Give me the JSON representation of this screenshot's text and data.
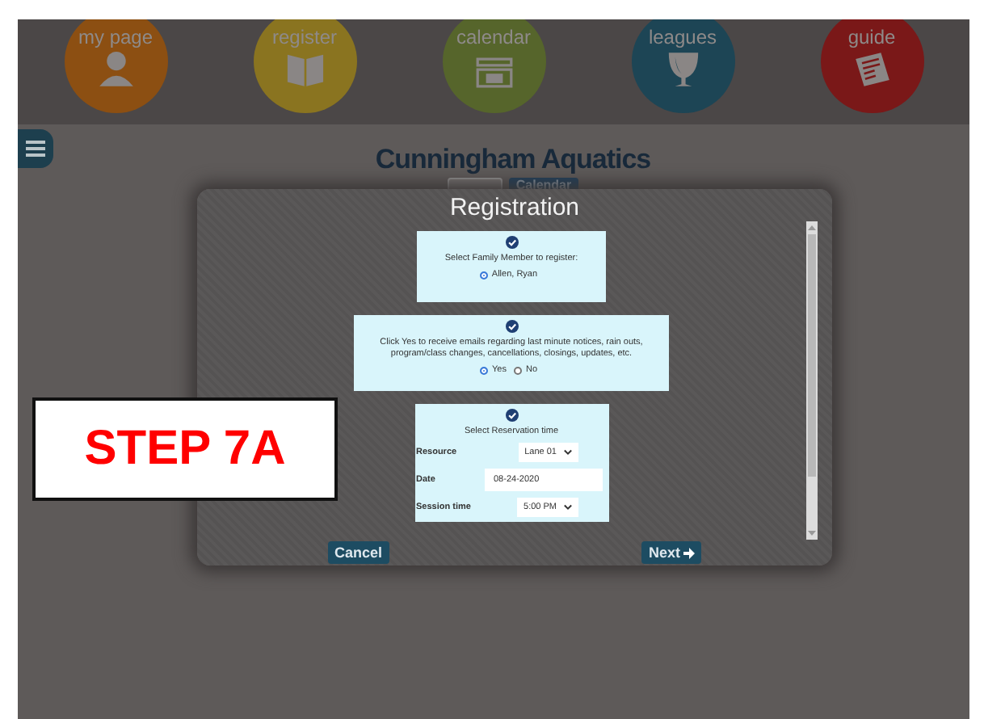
{
  "nav": [
    {
      "label": "my page",
      "color": "#8c4f12",
      "kind": "person"
    },
    {
      "label": "register",
      "color": "#8a7420",
      "kind": "book"
    },
    {
      "label": "calendar",
      "color": "#56652b",
      "kind": "calendar"
    },
    {
      "label": "leagues",
      "color": "#1d4555",
      "kind": "trophy"
    },
    {
      "label": "guide",
      "color": "#7a1818",
      "kind": "newspaper"
    }
  ],
  "site_title": "Cunningham Aquatics",
  "header_buttons": [
    {
      "kind": "plain"
    },
    {
      "kind": "calendar",
      "label": "Calendar"
    }
  ],
  "modal": {
    "title": "Registration",
    "sections": [
      {
        "kind": "choice",
        "prompt": "Select Family Member to register:",
        "options": [
          {
            "label": "Allen, Ryan",
            "selected": true
          }
        ]
      },
      {
        "kind": "choice",
        "prompt": "Click Yes to receive emails regarding last minute notices, rain outs, program/class changes, cancellations, closings, updates, etc.",
        "options": [
          {
            "label": "Yes",
            "selected": true
          },
          {
            "label": "No",
            "selected": false
          }
        ]
      },
      {
        "kind": "form",
        "prompt": "Select Reservation time",
        "fields": [
          {
            "label": "Resource",
            "kind": "select",
            "value": "Lane 01"
          },
          {
            "label": "Date",
            "kind": "input",
            "value": "08-24-2020"
          },
          {
            "label": "Session time",
            "kind": "select",
            "value": "5:00 PM"
          }
        ]
      }
    ],
    "buttons": [
      {
        "kind": "cancel",
        "label": "Cancel"
      },
      {
        "kind": "next",
        "label": "Next"
      }
    ]
  },
  "annotation": "STEP 7A"
}
